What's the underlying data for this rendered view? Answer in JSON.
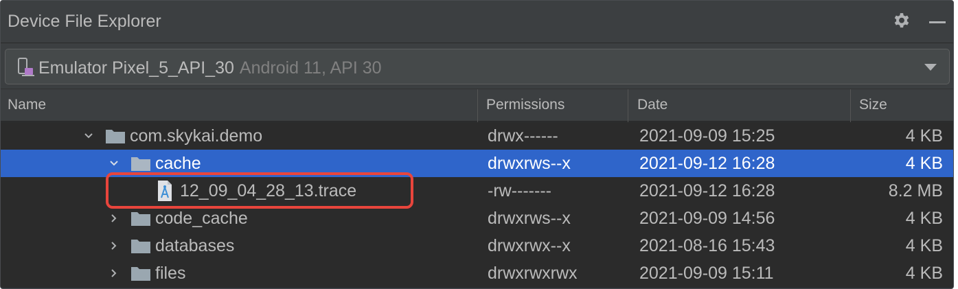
{
  "window": {
    "title": "Device File Explorer"
  },
  "icons": {
    "settings": "gear-icon",
    "minimize": "minimize-icon",
    "device": "device-icon",
    "folder": "folder-icon",
    "file": "trace-file-icon"
  },
  "colors": {
    "selection": "#2f65ca",
    "highlight": "#e8453c",
    "folder": "#9aa7b0"
  },
  "device": {
    "name": "Emulator Pixel_5_API_30",
    "detail": "Android 11, API 30"
  },
  "columns": {
    "name": "Name",
    "permissions": "Permissions",
    "date": "Date",
    "size": "Size"
  },
  "rows": [
    {
      "name": "com.skykai.demo",
      "permissions": "drwx------",
      "date": "2021-09-09 15:25",
      "size": "4 KB",
      "type": "folder",
      "expanded": true,
      "selected": false
    },
    {
      "name": "cache",
      "permissions": "drwxrws--x",
      "date": "2021-09-12 16:28",
      "size": "4 KB",
      "type": "folder",
      "expanded": true,
      "selected": true
    },
    {
      "name": "12_09_04_28_13.trace",
      "permissions": "-rw-------",
      "date": "2021-09-12 16:28",
      "size": "8.2 MB",
      "type": "file",
      "expanded": false,
      "selected": false
    },
    {
      "name": "code_cache",
      "permissions": "drwxrws--x",
      "date": "2021-09-09 14:56",
      "size": "4 KB",
      "type": "folder",
      "expanded": false,
      "selected": false
    },
    {
      "name": "databases",
      "permissions": "drwxrwx--x",
      "date": "2021-08-16 15:43",
      "size": "4 KB",
      "type": "folder",
      "expanded": false,
      "selected": false
    },
    {
      "name": "files",
      "permissions": "drwxrwxrwx",
      "date": "2021-09-09 15:11",
      "size": "4 KB",
      "type": "folder",
      "expanded": false,
      "selected": false
    }
  ]
}
